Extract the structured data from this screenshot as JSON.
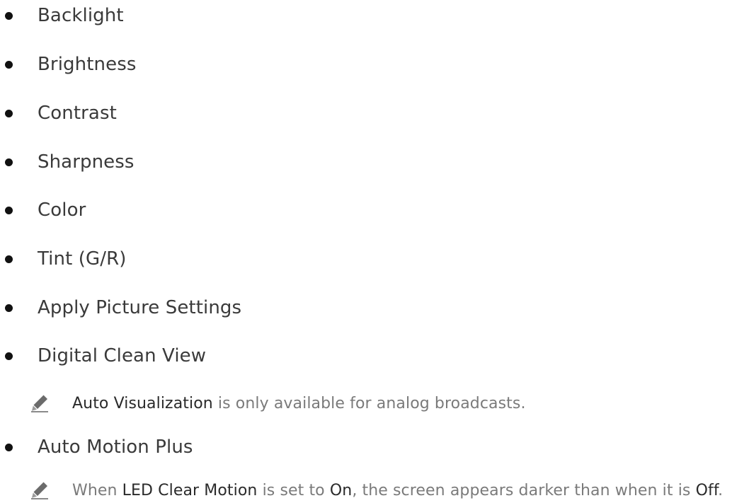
{
  "items": [
    {
      "label": "Backlight"
    },
    {
      "label": "Brightness"
    },
    {
      "label": "Contrast"
    },
    {
      "label": "Sharpness"
    },
    {
      "label": "Color"
    },
    {
      "label": "Tint (G/R)"
    },
    {
      "label": "Apply Picture Settings"
    },
    {
      "label": "Digital Clean View"
    },
    {
      "label": "Auto Motion Plus"
    }
  ],
  "notes": [
    {
      "icon": "pencil-note-icon",
      "parts": [
        {
          "text": "Auto Visualization",
          "strong": true
        },
        {
          "text": " is only available for analog broadcasts.",
          "strong": false
        }
      ]
    },
    {
      "icon": "pencil-note-icon",
      "parts": [
        {
          "text": "When ",
          "strong": false
        },
        {
          "text": "LED Clear Motion",
          "strong": true
        },
        {
          "text": " is set to ",
          "strong": false
        },
        {
          "text": "On",
          "strong": true
        },
        {
          "text": ", the screen appears darker than when it is ",
          "strong": false
        },
        {
          "text": "Off",
          "strong": true
        },
        {
          "text": ".",
          "strong": false
        }
      ]
    }
  ],
  "colors": {
    "bullet": "#111111",
    "item_text": "#3a3a3a",
    "note_text": "#7a7a7a",
    "note_emphasis": "#2a2a2a"
  }
}
